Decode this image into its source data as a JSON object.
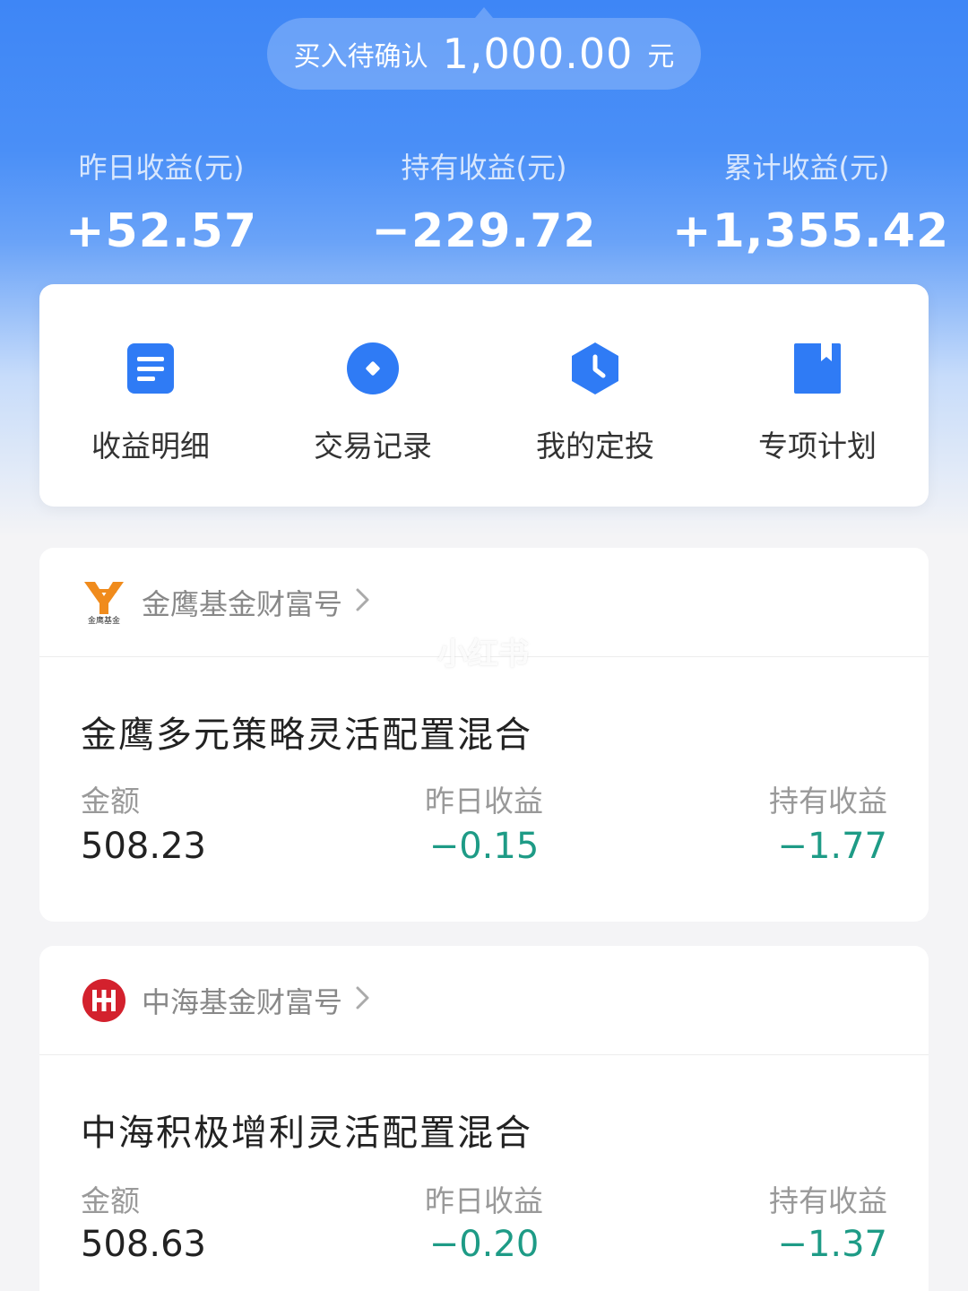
{
  "pending": {
    "label": "买入待确认",
    "amount": "1,000.00",
    "unit": "元"
  },
  "stats": [
    {
      "label": "昨日收益(元)",
      "value": "+52.57"
    },
    {
      "label": "持有收益(元)",
      "value": "−229.72"
    },
    {
      "label": "累计收益(元)",
      "value": "+1,355.42"
    }
  ],
  "quick_actions": [
    {
      "label": "收益明细",
      "icon": "document-icon"
    },
    {
      "label": "交易记录",
      "icon": "record-icon"
    },
    {
      "label": "我的定投",
      "icon": "clock-icon"
    },
    {
      "label": "专项计划",
      "icon": "bookmark-icon"
    }
  ],
  "funds": [
    {
      "brand": "金鹰基金财富号",
      "brand_logo_text": "金鹰基金",
      "name": "金鹰多元策略灵活配置混合",
      "amount_label": "金额",
      "amount": "508.23",
      "yesterday_label": "昨日收益",
      "yesterday": "−0.15",
      "holding_label": "持有收益",
      "holding": "−1.77"
    },
    {
      "brand": "中海基金财富号",
      "name": "中海积极增利灵活配置混合",
      "amount_label": "金额",
      "amount": "508.63",
      "yesterday_label": "昨日收益",
      "yesterday": "−0.20",
      "holding_label": "持有收益",
      "holding": "−1.37"
    }
  ],
  "watermark": "小红书",
  "colors": {
    "accent_blue": "#3e86f6",
    "icon_blue": "#2f7bf5",
    "loss_green": "#1e9b86"
  }
}
